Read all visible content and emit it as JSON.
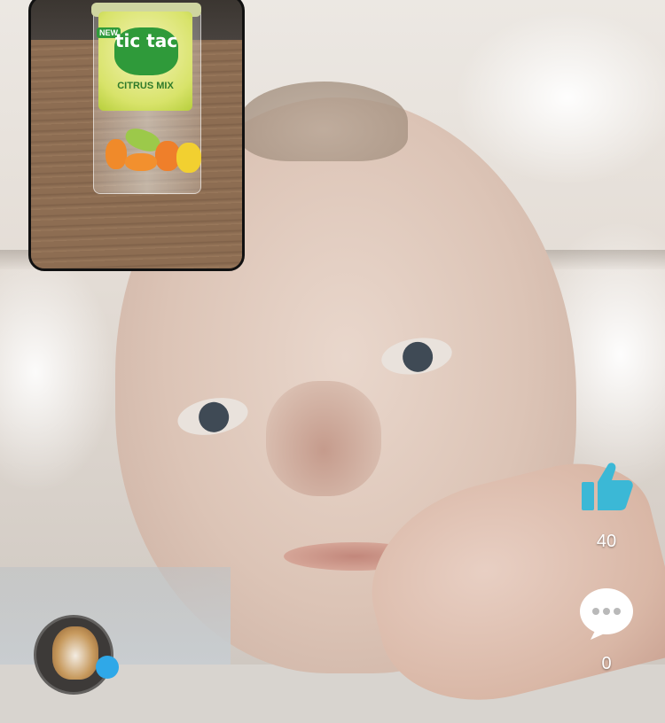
{
  "pip": {
    "product_badge": "NEW",
    "product_brand": "tic tac",
    "product_variant": "CITRUS MIX"
  },
  "actions": {
    "like_icon": "thumbs-up-icon",
    "like_count": "40",
    "comment_icon": "chat-bubble-icon",
    "comment_count": "0"
  },
  "colors": {
    "like_accent": "#3bb8d6",
    "comment_bubble": "#ffffff",
    "badge": "#2fa8e8"
  },
  "avatar": {
    "icon": "dog-avatar"
  }
}
